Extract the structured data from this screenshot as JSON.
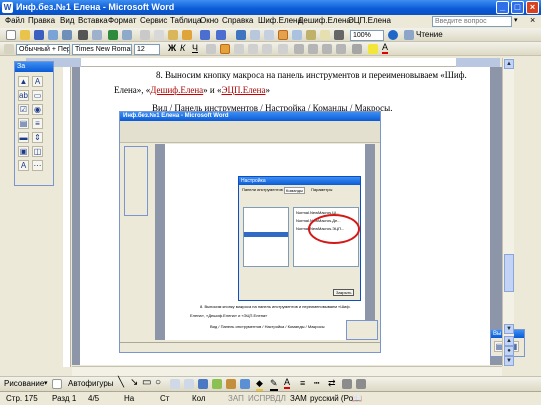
{
  "window": {
    "title": "Инф.без.№1 Елена - Microsoft Word",
    "app_icon": "W"
  },
  "menu": [
    "Файл",
    "Правка",
    "Вид",
    "Вставка",
    "Формат",
    "Сервис",
    "Таблица",
    "Окно",
    "Справка",
    "Шиф.Елена",
    "Дешиф.Елена",
    "ЭЦП.Елена"
  ],
  "help_box": {
    "placeholder": "Введите вопрос"
  },
  "standard_toolbar": {
    "zoom": "100%",
    "reading_label": "Чтение"
  },
  "format_toolbar": {
    "style": "Обычный + Пер",
    "font": "Times New Roman",
    "size": "12",
    "bold": "Ж",
    "italic": "К",
    "underline": "Ч"
  },
  "palette": {
    "title": "За"
  },
  "document": {
    "line1": "8. Выносим кнопку макроса на панель инструментов и переименовываем «Шиф.",
    "line2_prefix": "Елена», «",
    "line2_link1": "Дешиф.Елена",
    "line2_mid": "» и «",
    "line2_link2": "ЭЦП.Елена",
    "line2_suffix": "»",
    "line3": "Вид / Панель инструментов / Настройка / Команды / Макросы."
  },
  "embedded_screenshot": {
    "title": "Инф.без.№1 Елена - Microsoft Word",
    "dialog_title": "Настройка",
    "tabs": [
      "Панели инструментов",
      "Команды",
      "Параметры"
    ],
    "macro_items": [
      "Normal.NewMacros.Ш...",
      "Normal.NewMacros.Де...",
      "Normal.NewMacros.ЭЦП..."
    ],
    "caption1": "8. Выносим кнопку макроса на панель инструментов и переименовываем «Шиф.",
    "caption2": "Елена», «Дешиф.Елена» и «ЭЦП.Елена»",
    "caption3": "Вид / Панель инструментов / Настройка / Команды / Макросы",
    "close_label": "Закрыть"
  },
  "drawing_toolbar": {
    "draw_label": "Рисование",
    "autoshapes_label": "Автофигуры"
  },
  "status": {
    "page": "Стр. 175",
    "section": "Разд 1",
    "pages": "4/5",
    "at": "На",
    "line": "Ст",
    "col": "Кол",
    "rec": "ЗАП",
    "trk": "ИСПР",
    "ext": "ВДЛ",
    "ovr": "ЗАМ",
    "lang": "русский (Ро"
  }
}
